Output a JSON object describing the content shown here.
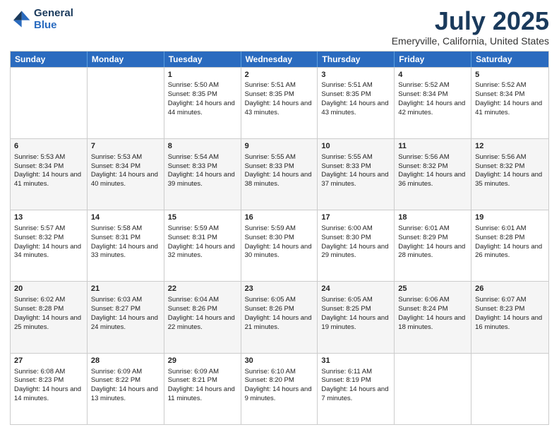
{
  "logo": {
    "line1": "General",
    "line2": "Blue"
  },
  "title": "July 2025",
  "location": "Emeryville, California, United States",
  "days_of_week": [
    "Sunday",
    "Monday",
    "Tuesday",
    "Wednesday",
    "Thursday",
    "Friday",
    "Saturday"
  ],
  "weeks": [
    [
      {
        "day": "",
        "sunrise": "",
        "sunset": "",
        "daylight": ""
      },
      {
        "day": "",
        "sunrise": "",
        "sunset": "",
        "daylight": ""
      },
      {
        "day": "1",
        "sunrise": "Sunrise: 5:50 AM",
        "sunset": "Sunset: 8:35 PM",
        "daylight": "Daylight: 14 hours and 44 minutes."
      },
      {
        "day": "2",
        "sunrise": "Sunrise: 5:51 AM",
        "sunset": "Sunset: 8:35 PM",
        "daylight": "Daylight: 14 hours and 43 minutes."
      },
      {
        "day": "3",
        "sunrise": "Sunrise: 5:51 AM",
        "sunset": "Sunset: 8:35 PM",
        "daylight": "Daylight: 14 hours and 43 minutes."
      },
      {
        "day": "4",
        "sunrise": "Sunrise: 5:52 AM",
        "sunset": "Sunset: 8:34 PM",
        "daylight": "Daylight: 14 hours and 42 minutes."
      },
      {
        "day": "5",
        "sunrise": "Sunrise: 5:52 AM",
        "sunset": "Sunset: 8:34 PM",
        "daylight": "Daylight: 14 hours and 41 minutes."
      }
    ],
    [
      {
        "day": "6",
        "sunrise": "Sunrise: 5:53 AM",
        "sunset": "Sunset: 8:34 PM",
        "daylight": "Daylight: 14 hours and 41 minutes."
      },
      {
        "day": "7",
        "sunrise": "Sunrise: 5:53 AM",
        "sunset": "Sunset: 8:34 PM",
        "daylight": "Daylight: 14 hours and 40 minutes."
      },
      {
        "day": "8",
        "sunrise": "Sunrise: 5:54 AM",
        "sunset": "Sunset: 8:33 PM",
        "daylight": "Daylight: 14 hours and 39 minutes."
      },
      {
        "day": "9",
        "sunrise": "Sunrise: 5:55 AM",
        "sunset": "Sunset: 8:33 PM",
        "daylight": "Daylight: 14 hours and 38 minutes."
      },
      {
        "day": "10",
        "sunrise": "Sunrise: 5:55 AM",
        "sunset": "Sunset: 8:33 PM",
        "daylight": "Daylight: 14 hours and 37 minutes."
      },
      {
        "day": "11",
        "sunrise": "Sunrise: 5:56 AM",
        "sunset": "Sunset: 8:32 PM",
        "daylight": "Daylight: 14 hours and 36 minutes."
      },
      {
        "day": "12",
        "sunrise": "Sunrise: 5:56 AM",
        "sunset": "Sunset: 8:32 PM",
        "daylight": "Daylight: 14 hours and 35 minutes."
      }
    ],
    [
      {
        "day": "13",
        "sunrise": "Sunrise: 5:57 AM",
        "sunset": "Sunset: 8:32 PM",
        "daylight": "Daylight: 14 hours and 34 minutes."
      },
      {
        "day": "14",
        "sunrise": "Sunrise: 5:58 AM",
        "sunset": "Sunset: 8:31 PM",
        "daylight": "Daylight: 14 hours and 33 minutes."
      },
      {
        "day": "15",
        "sunrise": "Sunrise: 5:59 AM",
        "sunset": "Sunset: 8:31 PM",
        "daylight": "Daylight: 14 hours and 32 minutes."
      },
      {
        "day": "16",
        "sunrise": "Sunrise: 5:59 AM",
        "sunset": "Sunset: 8:30 PM",
        "daylight": "Daylight: 14 hours and 30 minutes."
      },
      {
        "day": "17",
        "sunrise": "Sunrise: 6:00 AM",
        "sunset": "Sunset: 8:30 PM",
        "daylight": "Daylight: 14 hours and 29 minutes."
      },
      {
        "day": "18",
        "sunrise": "Sunrise: 6:01 AM",
        "sunset": "Sunset: 8:29 PM",
        "daylight": "Daylight: 14 hours and 28 minutes."
      },
      {
        "day": "19",
        "sunrise": "Sunrise: 6:01 AM",
        "sunset": "Sunset: 8:28 PM",
        "daylight": "Daylight: 14 hours and 26 minutes."
      }
    ],
    [
      {
        "day": "20",
        "sunrise": "Sunrise: 6:02 AM",
        "sunset": "Sunset: 8:28 PM",
        "daylight": "Daylight: 14 hours and 25 minutes."
      },
      {
        "day": "21",
        "sunrise": "Sunrise: 6:03 AM",
        "sunset": "Sunset: 8:27 PM",
        "daylight": "Daylight: 14 hours and 24 minutes."
      },
      {
        "day": "22",
        "sunrise": "Sunrise: 6:04 AM",
        "sunset": "Sunset: 8:26 PM",
        "daylight": "Daylight: 14 hours and 22 minutes."
      },
      {
        "day": "23",
        "sunrise": "Sunrise: 6:05 AM",
        "sunset": "Sunset: 8:26 PM",
        "daylight": "Daylight: 14 hours and 21 minutes."
      },
      {
        "day": "24",
        "sunrise": "Sunrise: 6:05 AM",
        "sunset": "Sunset: 8:25 PM",
        "daylight": "Daylight: 14 hours and 19 minutes."
      },
      {
        "day": "25",
        "sunrise": "Sunrise: 6:06 AM",
        "sunset": "Sunset: 8:24 PM",
        "daylight": "Daylight: 14 hours and 18 minutes."
      },
      {
        "day": "26",
        "sunrise": "Sunrise: 6:07 AM",
        "sunset": "Sunset: 8:23 PM",
        "daylight": "Daylight: 14 hours and 16 minutes."
      }
    ],
    [
      {
        "day": "27",
        "sunrise": "Sunrise: 6:08 AM",
        "sunset": "Sunset: 8:23 PM",
        "daylight": "Daylight: 14 hours and 14 minutes."
      },
      {
        "day": "28",
        "sunrise": "Sunrise: 6:09 AM",
        "sunset": "Sunset: 8:22 PM",
        "daylight": "Daylight: 14 hours and 13 minutes."
      },
      {
        "day": "29",
        "sunrise": "Sunrise: 6:09 AM",
        "sunset": "Sunset: 8:21 PM",
        "daylight": "Daylight: 14 hours and 11 minutes."
      },
      {
        "day": "30",
        "sunrise": "Sunrise: 6:10 AM",
        "sunset": "Sunset: 8:20 PM",
        "daylight": "Daylight: 14 hours and 9 minutes."
      },
      {
        "day": "31",
        "sunrise": "Sunrise: 6:11 AM",
        "sunset": "Sunset: 8:19 PM",
        "daylight": "Daylight: 14 hours and 7 minutes."
      },
      {
        "day": "",
        "sunrise": "",
        "sunset": "",
        "daylight": ""
      },
      {
        "day": "",
        "sunrise": "",
        "sunset": "",
        "daylight": ""
      }
    ]
  ]
}
